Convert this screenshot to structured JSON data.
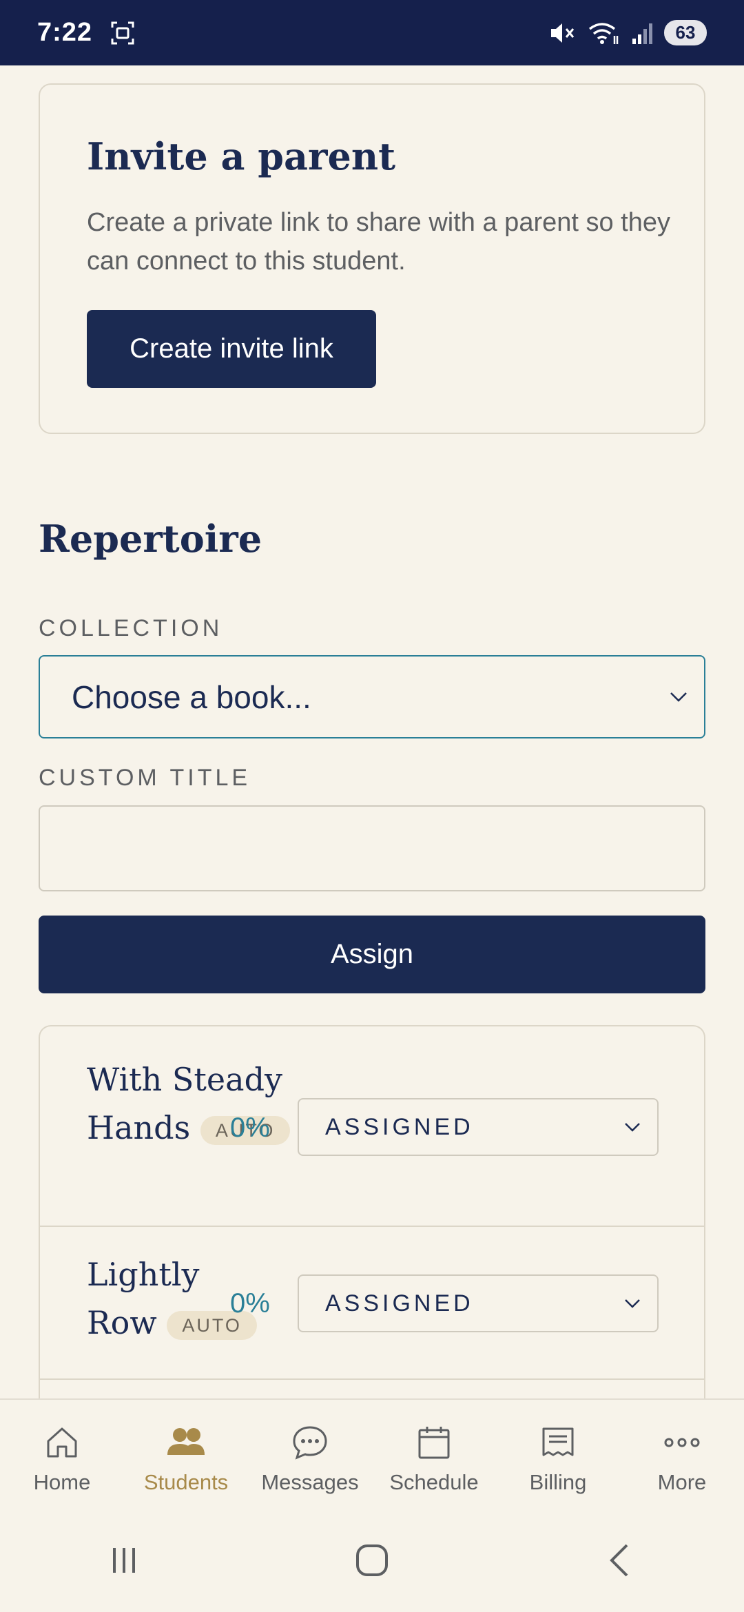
{
  "status_bar": {
    "time": "7:22",
    "battery": "63"
  },
  "invite": {
    "title": "Invite a parent",
    "description": "Create a private link to share with a parent so they can connect to this student.",
    "button_label": "Create invite link"
  },
  "repertoire": {
    "title": "Repertoire",
    "collection_label": "COLLECTION",
    "collection_value": "Choose a book...",
    "custom_title_label": "CUSTOM TITLE",
    "custom_title_value": "",
    "assign_label": "Assign",
    "items": [
      {
        "title": "With Steady Hands",
        "badge": "AUTO",
        "percent": "0%",
        "status": "ASSIGNED"
      },
      {
        "title": "Lightly Row",
        "badge": "AUTO",
        "percent": "0%",
        "status": "ASSIGNED"
      }
    ]
  },
  "nav": {
    "items": [
      {
        "label": "Home",
        "icon": "home-icon"
      },
      {
        "label": "Students",
        "icon": "students-icon",
        "active": true
      },
      {
        "label": "Messages",
        "icon": "messages-icon"
      },
      {
        "label": "Schedule",
        "icon": "calendar-icon"
      },
      {
        "label": "Billing",
        "icon": "billing-icon"
      },
      {
        "label": "More",
        "icon": "more-icon"
      }
    ]
  },
  "colors": {
    "navy": "#1b2a52",
    "accent_teal": "#2a7f97",
    "active_gold": "#a88a4a",
    "background": "#f7f3ea"
  }
}
